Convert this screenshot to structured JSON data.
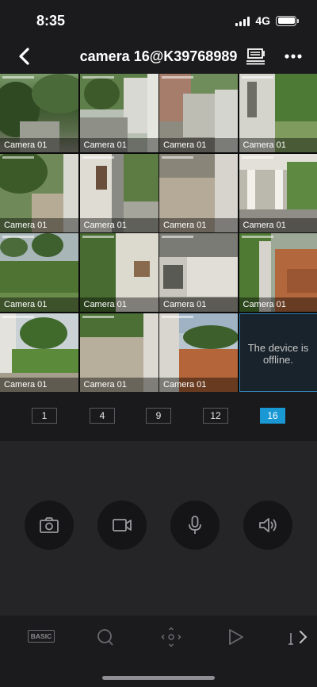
{
  "status_bar": {
    "time": "8:35",
    "network": "4G"
  },
  "header": {
    "title": "camera 16@K39768989"
  },
  "cameras": [
    {
      "label": "Camera 01"
    },
    {
      "label": "Camera 01"
    },
    {
      "label": "Camera 01"
    },
    {
      "label": "Camera 01"
    },
    {
      "label": "Camera 01"
    },
    {
      "label": "Camera 01"
    },
    {
      "label": "Camera 01"
    },
    {
      "label": "Camera 01"
    },
    {
      "label": "Camera 01"
    },
    {
      "label": "Camera 01"
    },
    {
      "label": "Camera 01"
    },
    {
      "label": "Camera 01"
    },
    {
      "label": "Camera 01"
    },
    {
      "label": "Camera 01"
    },
    {
      "label": "Camera 01"
    }
  ],
  "offline_message": "The device is offline.",
  "layouts": [
    "1",
    "4",
    "9",
    "12",
    "16"
  ],
  "active_layout": "16",
  "controls": [
    "camera-icon",
    "video-record-icon",
    "microphone-icon",
    "speaker-icon"
  ],
  "toolbar": {
    "basic_label": "BASIC"
  },
  "colors": {
    "accent": "#1a98d4",
    "background": "#1b1b1d",
    "panel": "#252527"
  }
}
